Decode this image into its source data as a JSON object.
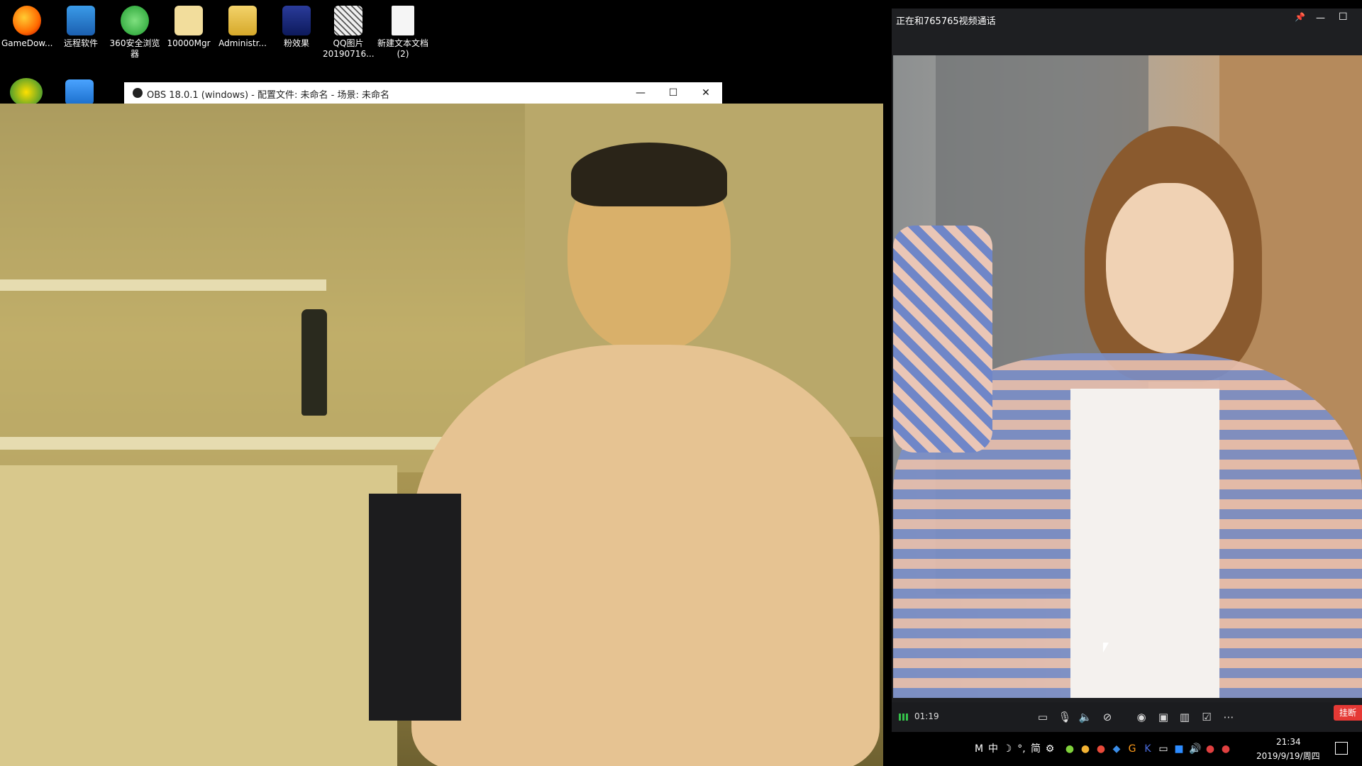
{
  "desktop": {
    "icons": [
      {
        "label": "GameDow..."
      },
      {
        "label": "远程软件"
      },
      {
        "label": "360安全浏览器"
      },
      {
        "label": "10000Mgr"
      },
      {
        "label": "Administr..."
      },
      {
        "label": "粉效果"
      },
      {
        "label": "QQ图片 20190716..."
      },
      {
        "label": "新建文本文档 (2)"
      }
    ]
  },
  "obs_window": {
    "title": "OBS 18.0.1 (windows) - 配置文件: 未命名 - 场景: 未命名",
    "minimize": "—",
    "maximize": "☐",
    "close": "✕"
  },
  "video_call": {
    "title": "正在和765765视频通话",
    "pin_icon": "📌",
    "minimize": "—",
    "maximize": "☐",
    "duration": "01:19",
    "hangup_label": "挂断",
    "controls": [
      "message-icon",
      "microphone-icon",
      "speaker-icon",
      "camera-off-icon",
      "screenshot-icon",
      "robot-icon",
      "layout-icon",
      "edit-icon",
      "more-icon"
    ]
  },
  "taskbar": {
    "ime": [
      "M",
      "中",
      "☽",
      "°,",
      "简",
      "⚙"
    ],
    "time": "21:34",
    "date": "2019/9/19/周四"
  },
  "colors": {
    "hangup": "#e53935",
    "signal": "#35c24a"
  }
}
